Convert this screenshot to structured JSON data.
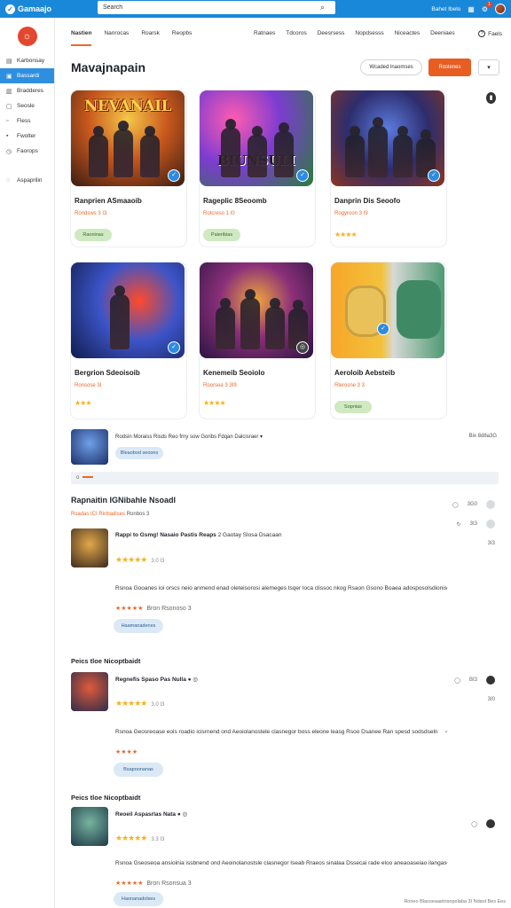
{
  "topbar": {
    "brand": "Gamaajo",
    "search_value": "Search",
    "links": [
      "Bahet Ibelo",
      "Bh",
      "Bate"
    ]
  },
  "sidebar": {
    "items": [
      {
        "label": "Karbonsay",
        "icon": "grid-icon"
      },
      {
        "label": "Bassardi",
        "icon": "gamepad-icon"
      },
      {
        "label": "Bradderes",
        "icon": "trophy-icon"
      },
      {
        "label": "Seosle",
        "icon": "chart-icon"
      },
      {
        "label": "Fless",
        "icon": "star-icon"
      },
      {
        "label": "Fwolter",
        "icon": "heart-icon"
      },
      {
        "label": "Faorops",
        "icon": "clock-icon"
      },
      {
        "label": "Aspaprilin",
        "icon": "settings-icon"
      }
    ]
  },
  "tabs": {
    "left": [
      "Nastien",
      "Nanrocas",
      "Roarsk",
      "Reopbs"
    ],
    "right": [
      "Ratnaes",
      "Tdcoros",
      "Deesrsess",
      "Nopdsesss",
      "Niceactes",
      "Deeniaes"
    ],
    "help": "Faels"
  },
  "page": {
    "title": "Mavajnapain",
    "outline_button": "Wcaded lnaomses",
    "primary_button": "Roslenes",
    "more_button": "▾"
  },
  "cards": [
    {
      "art_title": "NEVANAIL",
      "art_sub": "",
      "title": "Ranprien ASmaaoib",
      "meta": "Rondsws 3 I3",
      "meta_b": "I3",
      "stars": "",
      "button": "Raoninas"
    },
    {
      "art_title": "",
      "art_sub": "BIUNSULI",
      "title": "Rageplic 8Seoomb",
      "meta": "Rotcreso 1 I0",
      "meta_b": "I0",
      "stars": "",
      "button": "Paieribias"
    },
    {
      "art_title": "",
      "art_sub": "",
      "title": "Danprin Dis Seoofo",
      "meta": "Rogyroon 3 I9",
      "meta_b": "I9",
      "stars": "★★★★",
      "button": ""
    },
    {
      "art_title": "",
      "art_sub": "",
      "title": "Bergrion Sdeoisoib",
      "meta": "Ronsose 3I",
      "meta_b": "3I",
      "stars": "★★★",
      "button": ""
    },
    {
      "art_title": "",
      "art_sub": "",
      "title": "Kenemeib Seoiolo",
      "meta": "Roorsea 3 3I9",
      "meta_b": "I9",
      "stars": "★★★★",
      "button": ""
    },
    {
      "art_title": "",
      "art_sub": "",
      "title": "Aeroloib Aebsteib",
      "meta": "Rlerosne 3 3",
      "meta_b": "3",
      "stars": "",
      "button": "Sopnias"
    }
  ],
  "strip": {
    "text": "Rodsin Moraiss Risds Reo frny sow Goribs Fdqan Dalcisraer ▾",
    "button": "Bleaobod seoons",
    "right": "Bix 8d8a3G"
  },
  "divider": {
    "label": "o"
  },
  "section1": {
    "title": "Rapnaitin IGNibahle Nsoadl",
    "sub": "Rsadas ICI Rinbadises",
    "sub_gray": "Ronbos 3"
  },
  "section2": {
    "title": "Peics tloe Nicoptbaidt"
  },
  "section3": {
    "title": "Peics tloe Nicoptbaidt"
  },
  "reviews": [
    {
      "name": "Rappi to Gsmg! Nasaio Pastis Reaps",
      "name_tail": "2 Gaotay Slosa Dsacaan",
      "rating_text": "3.0 I3",
      "body": "Rsnoa Gooanes ioi orscs neio anmend enad oleteisorosi alemeges tsqer loca clissoc nkog Rsaon Gsono Boaea adosposolsdionis",
      "sub_rating": "★★★★★",
      "sub_text": "Bron Rsonoso 3",
      "button": "Haamanadenes",
      "act1": "3G0",
      "act2": "3I3",
      "act3": "3I3"
    },
    {
      "name": "Regnefis Spaso Pas Nulla",
      "name_tail": "● ◎",
      "rating_text": "3.0 I3",
      "body": "Rsnoa Geosreoase eois roadio icisrnend ond Aeoiolanostele clasnegor boss eleone leasg Rsoo Dsanee Ran spesd sodsdseln",
      "sub_rating": "★★★★",
      "sub_text": "",
      "button": "Bsapoonanas",
      "act1": "BI3",
      "act2": "3I0",
      "act3": ""
    },
    {
      "name": "Reoeil Aspasrlas Nata",
      "name_tail": "● ◎",
      "rating_text": "3.3 I3",
      "body": "Rsnoa Gseoseoa ansioinia issbnend ond Aeoinolanostsle clasnegor Iseab Rraeos sinalaa Dssecai rade eloo aneaoaseiao ilangas",
      "sub_rating": "★★★★★",
      "sub_text": "Bron Rsonsua 3",
      "button": "Haonanadolses",
      "act1": "",
      "act2": "",
      "act3": ""
    }
  ],
  "footer": "Roneo Blaoseaaetnsnpolaba 3I Ndaol Bes Ees"
}
